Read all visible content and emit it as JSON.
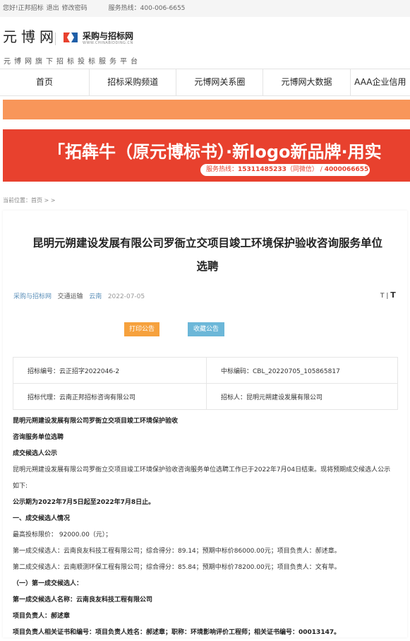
{
  "topbar": {
    "greeting": "您好!正邦招标",
    "logout": "退出",
    "change_password": "修改密码",
    "hotline": "服务热线：400-006-6655"
  },
  "header": {
    "logo_text": "元博网",
    "brand_name": "采购与招标网",
    "brand_sub": "WWW.CHINABIDDING.CN",
    "tagline": "元博网旗下招标投标服务平台"
  },
  "nav": [
    {
      "label": "首页"
    },
    {
      "label": "招标采购频道"
    },
    {
      "label": "元博网关系圈"
    },
    {
      "label": "元博网大数据"
    },
    {
      "label": "AAA企业信用"
    }
  ],
  "banner": {
    "title": "「拓犇牛（原元博标书）·新logo新品牌·用实",
    "hotline_label": "服务热线：",
    "phone": "15311485233",
    "wechat": "（同微信）",
    "sep": " / ",
    "phone2": "4000066655"
  },
  "breadcrumb": "当前位置：首页 > >",
  "article": {
    "title": "昆明元朔建设发展有限公司罗衙立交项目竣工环境保护验收咨询服务单位选聘",
    "source": "采购与招标网",
    "industry": "交通运输",
    "region": "云南",
    "date": "2022-07-05",
    "font_small": "T",
    "font_large": "T",
    "print_label": "打印公告",
    "fav_label": "收藏公告"
  },
  "info": {
    "bid_no": "招标编号：云正招字2022046-2",
    "win_no": "中标编码：CBL_20220705_105865817",
    "agent": "招标代理：云南正邦招标咨询有限公司",
    "tenderer": "招标人：昆明元朔建设发展有限公司"
  },
  "content": [
    {
      "text": "昆明元朔建设发展有限公司罗衙立交项目竣工环境保护验收",
      "bold": true
    },
    {
      "text": "咨询服务单位选聘",
      "bold": true
    },
    {
      "text": "成交候选人公示",
      "bold": true
    },
    {
      "text": "昆明元朔建设发展有限公司罗衙立交项目竣工环境保护验收咨询服务单位选聘工作已于2022年7月04日结束。现将预期成交候选人公示",
      "bold": false
    },
    {
      "text": "如下:",
      "bold": false
    },
    {
      "text": "公示期为2022年7月5日起至2022年7月8日止。",
      "bold": true
    },
    {
      "text": "一、成交候选人情况",
      "bold": true
    },
    {
      "text": "最高投标限价： 92000.00（元）；",
      "bold": false
    },
    {
      "text": "第一成交候选人：云南良友科技工程有限公司；综合得分：89.14；预期中标价86000.00元；项目负责人：郝述章。",
      "bold": false
    },
    {
      "text": "第二成交候选人：云南顺测环保工程有限公司；综合得分：85.84；预期中标价78200.00元；项目负责人：文有苹。",
      "bold": false
    },
    {
      "text": "（一）第一成交候选人：",
      "bold": true
    },
    {
      "text": "第一成交候选人名称：云南良友科技工程有限公司",
      "bold": true
    },
    {
      "text": "项目负责人：郝述章",
      "bold": true
    },
    {
      "text": "项目负责人相关证书和编号：项目负责人姓名：郝述章；职称：环境影响评价工程师；相关证书编号：00013147。",
      "bold": true
    }
  ],
  "colors": {
    "banner_red": "#e8412e",
    "strip_orange": "#f8965a",
    "print_btn": "#f6a13d",
    "fav_btn": "#6cb7d8",
    "link_blue": "#5b8fb9"
  }
}
